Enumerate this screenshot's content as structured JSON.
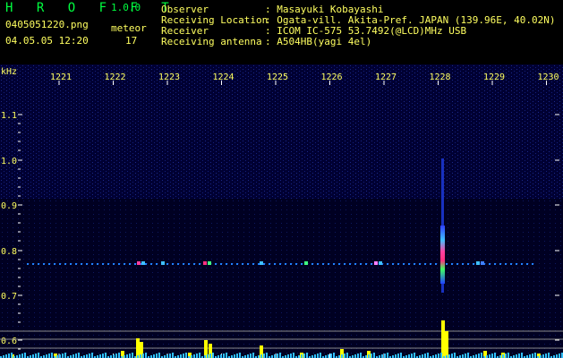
{
  "app": {
    "title": "H R O F F T",
    "version": "1.0.0"
  },
  "file": {
    "name": "0405051220.png",
    "datetime": "04.05.05 12:20"
  },
  "detection": {
    "label": "meteor",
    "count": "17"
  },
  "info": [
    {
      "key": "Observer",
      "value": ": Masayuki Kobayashi"
    },
    {
      "key": "Receiving Location",
      "value": ": Ogata-vill. Akita-Pref. JAPAN (139.96E, 40.02N)"
    },
    {
      "key": "Receiver",
      "value": ": ICOM IC-575 53.7492(@LCD)MHz USB"
    },
    {
      "key": "Receiving antenna",
      "value": ": A504HB(yagi 4el)"
    }
  ],
  "spectrogram": {
    "y_unit": "kHz",
    "x_ticks": [
      "1221",
      "1222",
      "1223",
      "1224",
      "1225",
      "1226",
      "1227",
      "1228",
      "1229",
      "1230"
    ],
    "y_ticks": [
      "1.1",
      "1.0",
      "0.9",
      "0.8",
      "0.7",
      "0.6"
    ],
    "colors": {
      "background": "#000040",
      "label": "#ffff60",
      "tick": "#ffffff",
      "accent": "#00ff40",
      "echo": "#ff40a0",
      "monitor": "#ffff00"
    }
  }
}
